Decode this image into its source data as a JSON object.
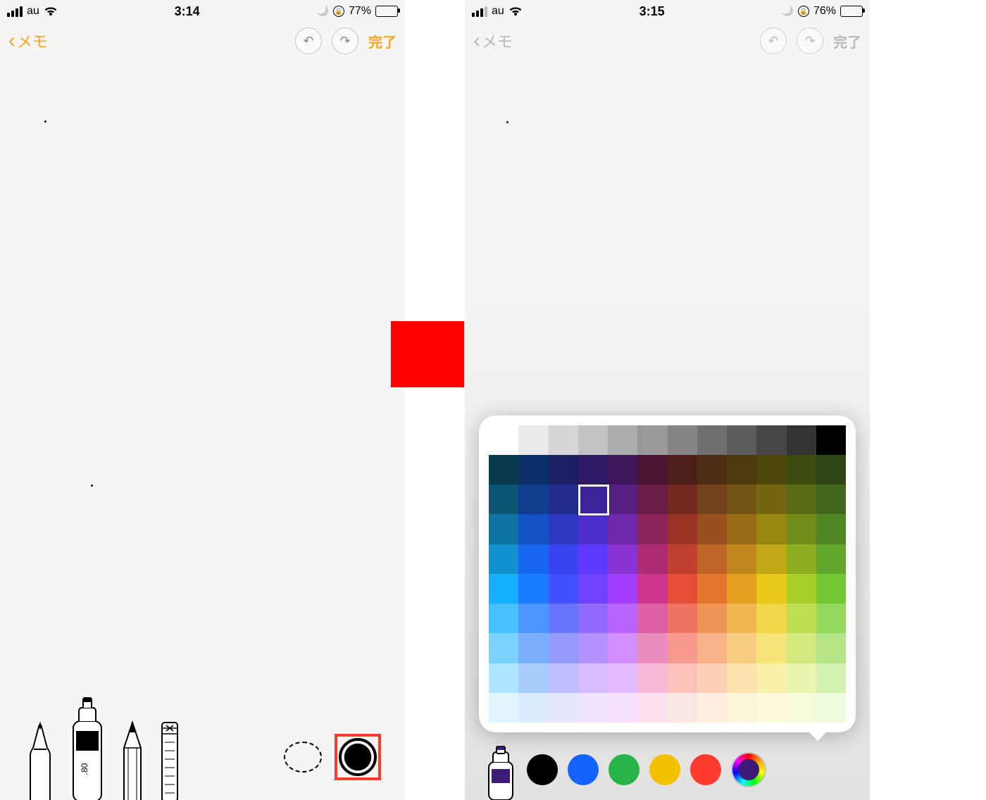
{
  "left": {
    "status": {
      "carrier": "au",
      "time": "3:14",
      "battery_text": "77%",
      "battery_fill": 77,
      "signal_lost": false
    },
    "nav": {
      "back_label": "メモ",
      "done_label": "完了"
    },
    "tools": {
      "items": [
        {
          "name": "pen-tool"
        },
        {
          "name": "marker-tool",
          "tip_label": ".80"
        },
        {
          "name": "pencil-tool"
        },
        {
          "name": "ruler-tool"
        },
        {
          "name": "lasso-tool"
        },
        {
          "name": "color-indicator"
        }
      ],
      "selected_color": "#000000",
      "highlight_color_indicator": true
    }
  },
  "right": {
    "status": {
      "carrier": "au",
      "time": "3:15",
      "battery_text": "76%",
      "battery_fill": 76,
      "signal_lost": true
    },
    "nav": {
      "back_label": "メモ",
      "done_label": "完了"
    },
    "color_row": {
      "swatches": [
        "#000000",
        "#1463ff",
        "#27b24a",
        "#f2c200",
        "#ff3b30"
      ],
      "current": "#3b1a78"
    },
    "color_popup": {
      "rows": 10,
      "cols": 12,
      "colors": [
        [
          "#ffffff",
          "#ebebeb",
          "#d6d6d6",
          "#c2c2c2",
          "#adadad",
          "#999999",
          "#858585",
          "#707070",
          "#5c5c5c",
          "#474747",
          "#333333",
          "#000000"
        ],
        [
          "#0a3b4c",
          "#0a2f66",
          "#1a1f66",
          "#2e1a66",
          "#3d1759",
          "#4c1433",
          "#4c1f1a",
          "#4c2e14",
          "#4c3b0f",
          "#4c470a",
          "#3d4c0f",
          "#2e4714"
        ],
        [
          "#0d5673",
          "#0f3f8c",
          "#232b8c",
          "#3d2399",
          "#552080",
          "#6b1c47",
          "#73291f",
          "#73411a",
          "#735414",
          "#73660f",
          "#596b14",
          "#40661c"
        ],
        [
          "#0f73a1",
          "#1352c2",
          "#2d37c2",
          "#4e2ecc",
          "#7029aa",
          "#8c235c",
          "#993326",
          "#994f1f",
          "#996b17",
          "#99880f",
          "#718c19",
          "#4f8523"
        ],
        [
          "#1291cf",
          "#1666f0",
          "#3744f0",
          "#5f39ff",
          "#8a33d4",
          "#ad2c73",
          "#bf402e",
          "#bf6326",
          "#bf871d",
          "#bfa814",
          "#8cad1f",
          "#62a62c"
        ],
        [
          "#14afff",
          "#1a7aff",
          "#4151ff",
          "#6f42ff",
          "#a33cfe",
          "#cf348a",
          "#e54d36",
          "#e5762e",
          "#e69f22",
          "#e6c818",
          "#a7cf25",
          "#74c734"
        ],
        [
          "#47c0ff",
          "#4a95ff",
          "#6a75ff",
          "#916aff",
          "#b964ff",
          "#dd5fa4",
          "#ef7361",
          "#ef9459",
          "#f0b652",
          "#f0d648",
          "#bedd52",
          "#95d85e"
        ],
        [
          "#7ad3ff",
          "#7ab0ff",
          "#949aff",
          "#b393ff",
          "#d08eff",
          "#eb8cbe",
          "#f79a8d",
          "#f7b287",
          "#f7cd82",
          "#f7e479",
          "#d4ea7f",
          "#b6e588"
        ],
        [
          "#aee5ff",
          "#aacdff",
          "#bfbfff",
          "#d4bcff",
          "#e5b9ff",
          "#f5b8d8",
          "#fbc2b9",
          "#fbd0b4",
          "#fbe0b0",
          "#fbf0aa",
          "#e8f4ad",
          "#d5f2b3"
        ],
        [
          "#e0f5ff",
          "#dcebff",
          "#e6e6ff",
          "#efe3ff",
          "#f5e1ff",
          "#fbe1ef",
          "#fde7e2",
          "#fdeedf",
          "#fdf4dc",
          "#fdfadb",
          "#f5fbdc",
          "#eefade"
        ]
      ],
      "selected": {
        "row": 2,
        "col": 3
      }
    }
  }
}
